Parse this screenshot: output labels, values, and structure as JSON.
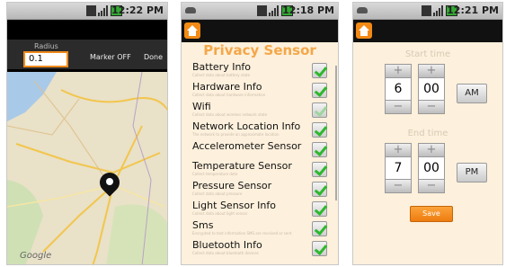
{
  "screens": [
    {
      "status_time": "12:22 PM",
      "radius_label": "Radius",
      "radius_value": "0.1",
      "marker_button": "Marker OFF",
      "done_button": "Done",
      "map_logo": "Google"
    },
    {
      "status_time": "12:18 PM",
      "title": "Privacy Sensor",
      "sensors": [
        {
          "name": "Battery Info",
          "desc": "Collect data about battery state",
          "checked": true
        },
        {
          "name": "Hardware Info",
          "desc": "Collect data about hardware information",
          "checked": true
        },
        {
          "name": "Wifi",
          "desc": "Collect data about wireless network state",
          "checked": true
        },
        {
          "name": "Network Location Info",
          "desc": "The network to provide an approximate location",
          "checked": true
        },
        {
          "name": "Accelerometer Sensor",
          "desc": "",
          "checked": true
        },
        {
          "name": "Temperature Sensor",
          "desc": "Collect temperature data",
          "checked": true
        },
        {
          "name": "Pressure Sensor",
          "desc": "Collect data about pressure",
          "checked": true
        },
        {
          "name": "Light Sensor Info",
          "desc": "Collect data about light sensor",
          "checked": true
        },
        {
          "name": "Sms",
          "desc": "Encrypted to text information SMS are received or sent",
          "checked": true
        },
        {
          "name": "Bluetooth Info",
          "desc": "Collect data about bluetooth devices",
          "checked": true
        }
      ]
    },
    {
      "status_time": "12:21 PM",
      "start_label": "Start time",
      "end_label": "End time",
      "start": {
        "hour": "6",
        "minute": "00",
        "ampm": "AM"
      },
      "end": {
        "hour": "7",
        "minute": "00",
        "ampm": "PM"
      },
      "plus": "+",
      "minus": "−",
      "save_button": "Save"
    }
  ],
  "colors": {
    "accent": "#f28a15",
    "title": "#f4a74a",
    "check": "#2eb82e",
    "panel_bg": "#fdf0dc"
  }
}
